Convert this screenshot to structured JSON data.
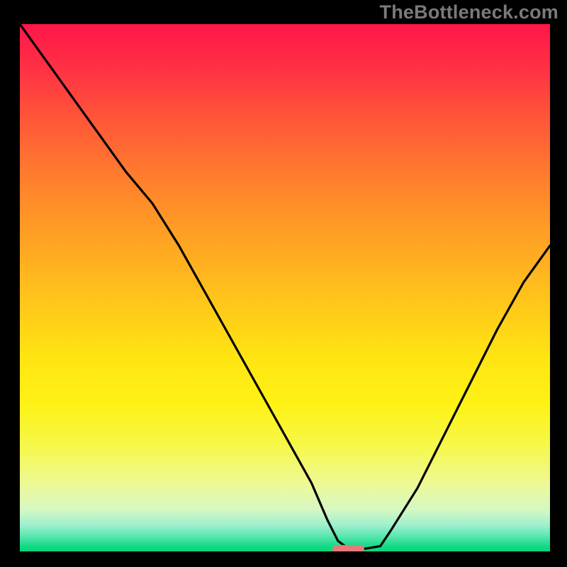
{
  "watermark": "TheBottleneck.com",
  "colors": {
    "frame_bg": "#000000",
    "marker": "#e77a79",
    "curve": "#000000"
  },
  "chart_data": {
    "type": "line",
    "title": "",
    "xlabel": "",
    "ylabel": "",
    "xlim": [
      0,
      100
    ],
    "ylim": [
      0,
      100
    ],
    "x": [
      0,
      5,
      10,
      15,
      20,
      25,
      30,
      35,
      40,
      45,
      50,
      55,
      58,
      60,
      62,
      65,
      68,
      70,
      75,
      80,
      85,
      90,
      95,
      100
    ],
    "values": [
      100,
      93,
      86,
      79,
      72,
      66,
      58,
      49,
      40,
      31,
      22,
      13,
      6,
      2,
      0.5,
      0.5,
      1,
      4,
      12,
      22,
      32,
      42,
      51,
      58
    ],
    "marker": {
      "x_center": 62,
      "width": 6,
      "y": 0
    },
    "notes": "Gradient background red→yellow→green (top→bottom). Curve shows bottleneck-style V with minimum near x≈62."
  }
}
